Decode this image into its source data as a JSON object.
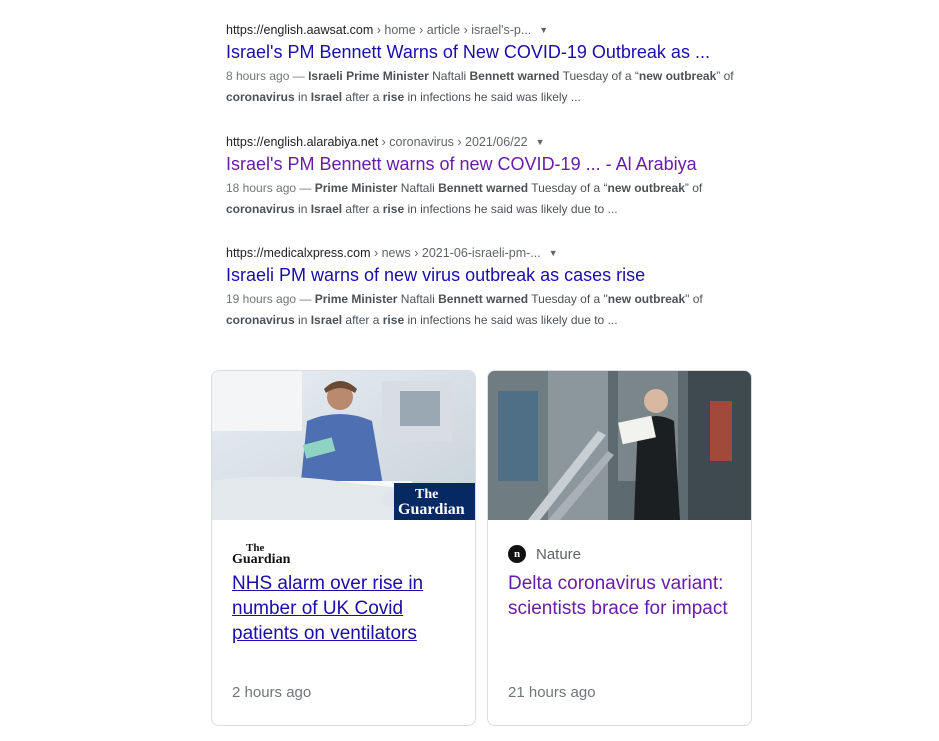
{
  "results": [
    {
      "url": "https://english.aawsat.com",
      "path": " › home › article › israel's-p...",
      "title": "Israel's PM Bennett Warns of New COVID-19 Outbreak as ...",
      "visited": false,
      "snippet": [
        {
          "t": "8 hours ago — ",
          "s": "date"
        },
        {
          "t": "Israeli Prime Minister",
          "s": "b"
        },
        {
          "t": " Naftali ",
          "s": ""
        },
        {
          "t": "Bennett warned",
          "s": "b"
        },
        {
          "t": " Tuesday of a “",
          "s": ""
        },
        {
          "t": "new outbreak",
          "s": "b"
        },
        {
          "t": "” of",
          "s": ""
        },
        {
          "t": "\n",
          "s": "br"
        },
        {
          "t": "coronavirus",
          "s": "b"
        },
        {
          "t": " in ",
          "s": ""
        },
        {
          "t": "Israel",
          "s": "b"
        },
        {
          "t": " after a ",
          "s": ""
        },
        {
          "t": "rise",
          "s": "b"
        },
        {
          "t": " in infections he said was likely ...",
          "s": ""
        }
      ]
    },
    {
      "url": "https://english.alarabiya.net",
      "path": " › coronavirus › 2021/06/22",
      "title": "Israel's PM Bennett warns of new COVID-19 ... - Al Arabiya",
      "visited": true,
      "snippet": [
        {
          "t": "18 hours ago — ",
          "s": "date"
        },
        {
          "t": "Prime Minister",
          "s": "b"
        },
        {
          "t": " Naftali ",
          "s": ""
        },
        {
          "t": "Bennett warned",
          "s": "b"
        },
        {
          "t": " Tuesday of a “",
          "s": ""
        },
        {
          "t": "new outbreak",
          "s": "b"
        },
        {
          "t": "” of",
          "s": ""
        },
        {
          "t": "\n",
          "s": "br"
        },
        {
          "t": "coronavirus",
          "s": "b"
        },
        {
          "t": " in ",
          "s": ""
        },
        {
          "t": "Israel",
          "s": "b"
        },
        {
          "t": " after a ",
          "s": ""
        },
        {
          "t": "rise",
          "s": "b"
        },
        {
          "t": " in infections he said was likely due to ...",
          "s": ""
        }
      ]
    },
    {
      "url": "https://medicalxpress.com",
      "path": " › news › 2021-06-israeli-pm-...",
      "title": "Israeli PM warns of new virus outbreak as cases rise",
      "visited": false,
      "snippet": [
        {
          "t": "19 hours ago — ",
          "s": "date"
        },
        {
          "t": "Prime Minister",
          "s": "b"
        },
        {
          "t": " Naftali ",
          "s": ""
        },
        {
          "t": "Bennett warned",
          "s": "b"
        },
        {
          "t": " Tuesday of a \"",
          "s": ""
        },
        {
          "t": "new outbreak",
          "s": "b"
        },
        {
          "t": "\" of",
          "s": ""
        },
        {
          "t": "\n",
          "s": "br"
        },
        {
          "t": "coronavirus",
          "s": "b"
        },
        {
          "t": " in ",
          "s": ""
        },
        {
          "t": "Israel",
          "s": "b"
        },
        {
          "t": " after a ",
          "s": ""
        },
        {
          "t": "rise",
          "s": "b"
        },
        {
          "t": " in infections he said was likely due to ...",
          "s": ""
        }
      ]
    }
  ],
  "cards": [
    {
      "source": "The Guardian",
      "logo_line1": "The",
      "logo_line2": "Guardian",
      "title": "NHS alarm over rise in number of UK Covid patients on ventilators",
      "time": "2 hours ago",
      "thumb_logo_line1": "The",
      "thumb_logo_line2": "Guardian"
    },
    {
      "source": "Nature",
      "icon": "n",
      "title": "Delta coronavirus variant: scientists brace for impact",
      "time": "21 hours ago"
    }
  ],
  "menu_icon": "▼",
  "colors": {
    "link": "#1a0dab",
    "visited": "#681da8",
    "text": "#4d5156",
    "meta": "#70757a"
  }
}
